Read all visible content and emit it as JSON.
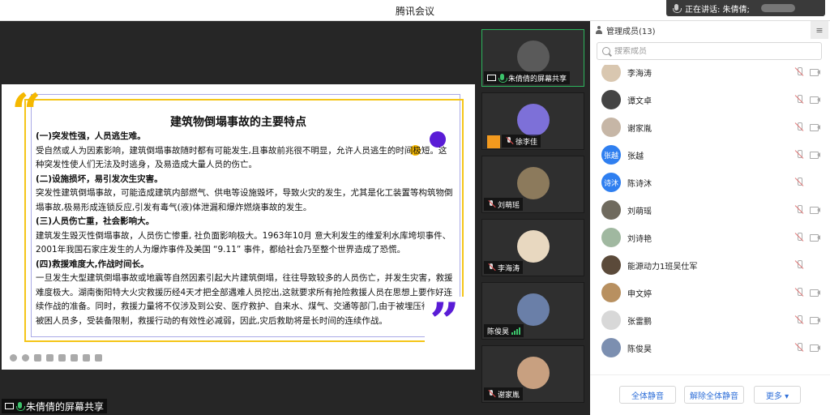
{
  "window": {
    "title": "腾讯会议"
  },
  "speaking": {
    "label": "正在讲话: 朱倩倩;"
  },
  "slide": {
    "title": "建筑物倒塌事故的主要特点",
    "paragraphs": [
      {
        "text": "(一)突发性强，人员逃生难。",
        "heading": true
      },
      {
        "text": "受自然或人为因素影响，建筑倒塌事故随时都有可能发生,且事故前兆很不明显，允许人员逃生的时间极短。这种突发性使人们无法及时逃身，及易造成大量人员的伤亡。",
        "heading": false
      },
      {
        "text": "(二)设施损坏，易引发次生灾害。",
        "heading": true
      },
      {
        "text": "突发性建筑倒塌事故，可能造成建筑内部燃气、供电等设施毁坏，导致火灾的发生，尤其是化工装置等构筑物倒塌事故,极易形成连锁反应,引发有毒气(液)体泄漏和爆炸燃烧事故的发生。",
        "heading": false
      },
      {
        "text": "(三)人员伤亡重，社会影响大。",
        "heading": true
      },
      {
        "text": "建筑发生毁灭性倒塌事故，人员伤亡惨重, 社负面影响极大。1963年10月 意大利发生的维爱利水库垮坝事件、2001年我国石家庄发生的人为爆炸事件及美国 “9.11” 事件，都给社会乃至整个世界造成了恐慌。",
        "heading": false
      },
      {
        "text": "(四)救援难度大,作战时间长。",
        "heading": true
      },
      {
        "text": "一旦发生大型建筑倒塌事故或地震等自然因素引起大片建筑倒塌，往往导致较多的人员伤亡，并发生灾害，救援难度极大。湖南衡阳特大火灾救援历经4天才把全部遇难人员挖出,这就要求所有抢险救援人员在思想上要作好连续作战的准备。同时，救援力量将不仅涉及到公安、医疗救护、自来水、煤气、交通等部门,由于被埋压待救的被困人员多，受装备限制，救援行动的有效性必减弱，因此,灾后救助将是长时间的连续作战。",
        "heading": false
      }
    ]
  },
  "sharer_label": "朱倩倩的屏幕共享",
  "video_tiles": [
    {
      "name": "朱倩倩的屏幕共享",
      "avatar_color": "#5a5a5a",
      "active": true,
      "icon": "share"
    },
    {
      "name": "徐李佳",
      "avatar_color": "#7d70d8",
      "active": false,
      "icon": "mute"
    },
    {
      "name": "刘萌瑶",
      "avatar_color": "#8c7a5c",
      "active": false,
      "icon": "mute"
    },
    {
      "name": "李海涛",
      "avatar_color": "#e8d8c0",
      "active": false,
      "icon": "mute"
    },
    {
      "name": "陈俊昊",
      "avatar_color": "#6a7fa8",
      "active": false,
      "icon": "bars"
    },
    {
      "name": "谢家胤",
      "avatar_color": "#c8a080",
      "active": false,
      "icon": "mute"
    }
  ],
  "panel": {
    "title": "管理成员(13)",
    "search_placeholder": "搜索成员",
    "members": [
      {
        "name": "李海涛",
        "avatar_text": "",
        "avatar_color": "#d9c7b0",
        "cam": true
      },
      {
        "name": "谭文卓",
        "avatar_text": "",
        "avatar_color": "#444444",
        "cam": true
      },
      {
        "name": "谢家胤",
        "avatar_text": "",
        "avatar_color": "#c6b6a6",
        "cam": true
      },
      {
        "name": "张越",
        "avatar_text": "张越",
        "avatar_color": "#2f7ff0",
        "cam": true
      },
      {
        "name": "陈诗沐",
        "avatar_text": "诗沐",
        "avatar_color": "#2f7ff0",
        "cam": false
      },
      {
        "name": "刘萌瑶",
        "avatar_text": "",
        "avatar_color": "#6f6a5e",
        "cam": true
      },
      {
        "name": "刘诗艳",
        "avatar_text": "",
        "avatar_color": "#a0b8a0",
        "cam": true
      },
      {
        "name": "能源动力1班吴仕军",
        "avatar_text": "",
        "avatar_color": "#5b4a3a",
        "cam": false
      },
      {
        "name": "申文婷",
        "avatar_text": "",
        "avatar_color": "#b89060",
        "cam": true
      },
      {
        "name": "张雷鹏",
        "avatar_text": "",
        "avatar_color": "#d8d8d8",
        "cam": true
      },
      {
        "name": "陈俊昊",
        "avatar_text": "",
        "avatar_color": "#7c8fb0",
        "cam": true
      }
    ],
    "buttons": {
      "mute_all": "全体静音",
      "unmute_all": "解除全体静音",
      "more": "更多 ▾"
    }
  }
}
